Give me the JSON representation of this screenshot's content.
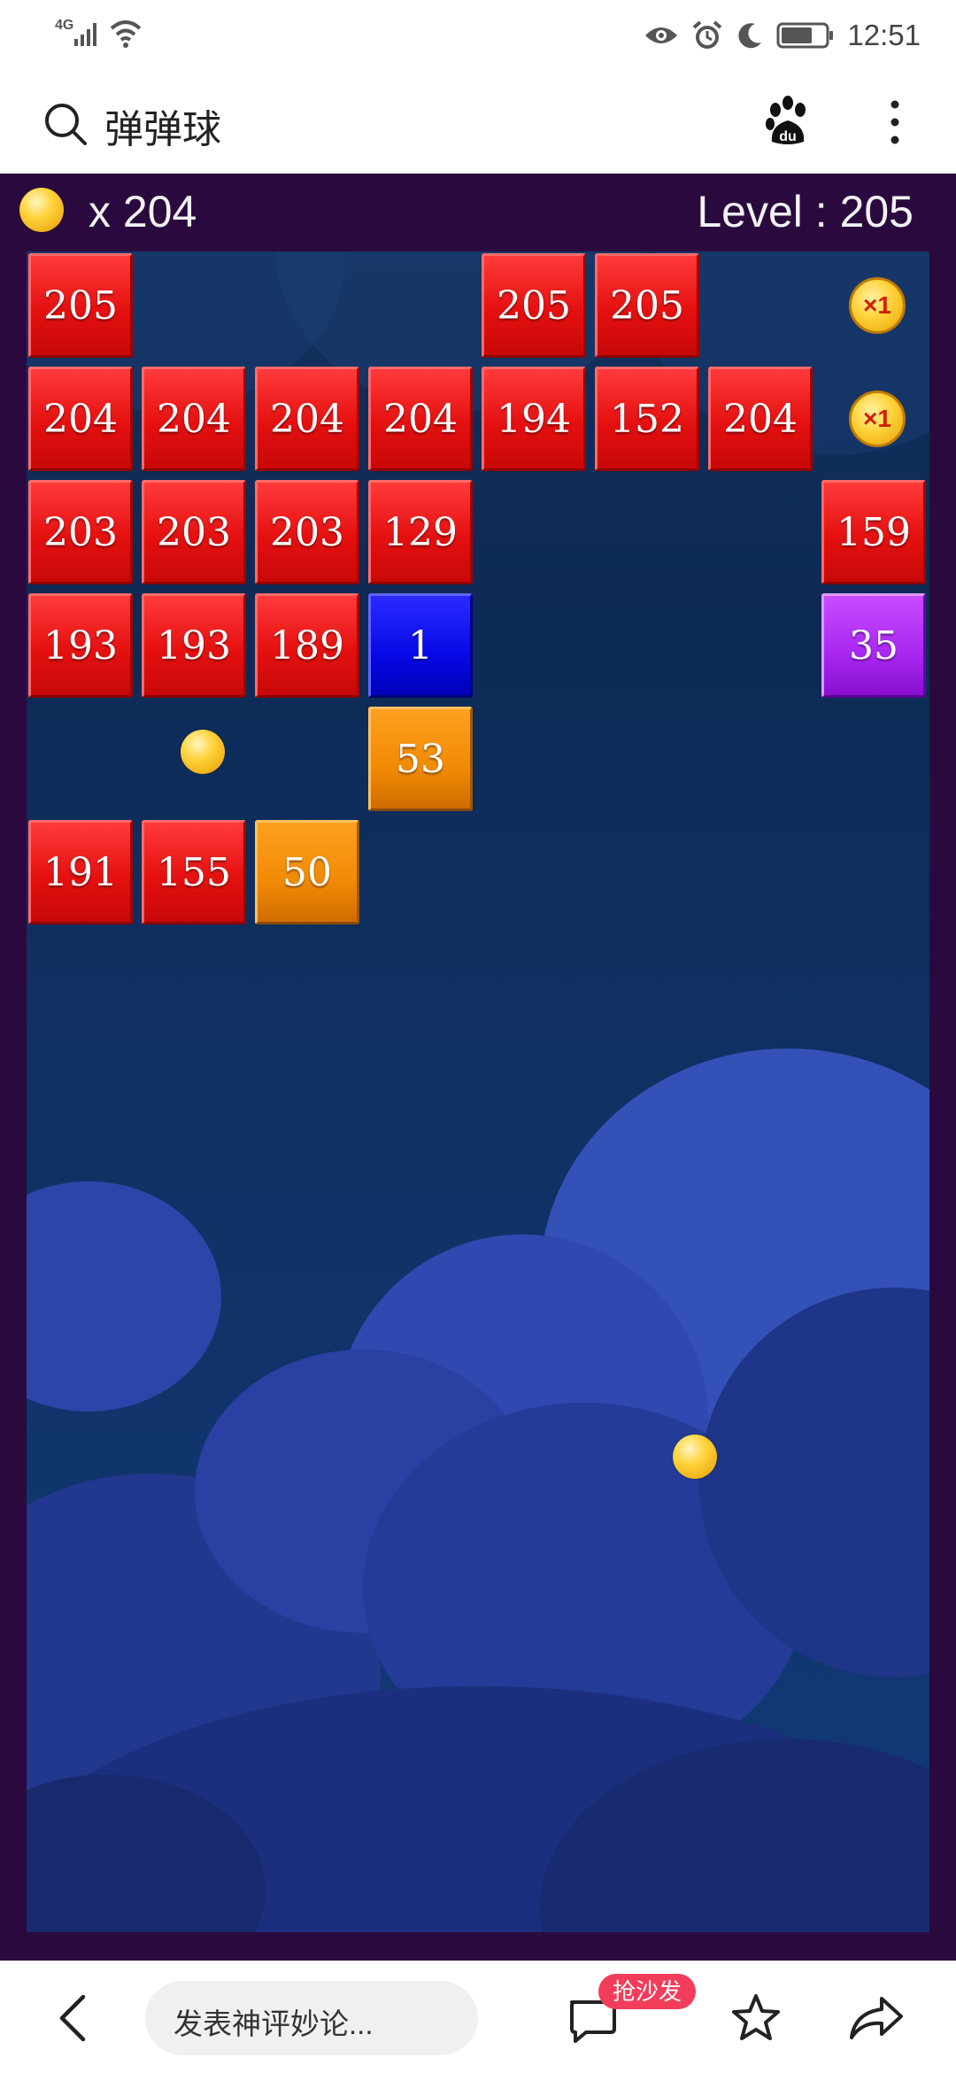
{
  "status_bar": {
    "network": "4G",
    "time": "12:51"
  },
  "search": {
    "query": "弹弹球"
  },
  "game": {
    "coins": "x 204",
    "level": "Level : 205",
    "blocks": [
      {
        "row": 0,
        "col": 0,
        "value": "205",
        "color": "red"
      },
      {
        "row": 0,
        "col": 4,
        "value": "205",
        "color": "red"
      },
      {
        "row": 0,
        "col": 5,
        "value": "205",
        "color": "red"
      },
      {
        "row": 1,
        "col": 0,
        "value": "204",
        "color": "red"
      },
      {
        "row": 1,
        "col": 1,
        "value": "204",
        "color": "red"
      },
      {
        "row": 1,
        "col": 2,
        "value": "204",
        "color": "red"
      },
      {
        "row": 1,
        "col": 3,
        "value": "204",
        "color": "red"
      },
      {
        "row": 1,
        "col": 4,
        "value": "194",
        "color": "red"
      },
      {
        "row": 1,
        "col": 5,
        "value": "152",
        "color": "red"
      },
      {
        "row": 1,
        "col": 6,
        "value": "204",
        "color": "red"
      },
      {
        "row": 2,
        "col": 0,
        "value": "203",
        "color": "red"
      },
      {
        "row": 2,
        "col": 1,
        "value": "203",
        "color": "red"
      },
      {
        "row": 2,
        "col": 2,
        "value": "203",
        "color": "red"
      },
      {
        "row": 2,
        "col": 3,
        "value": "129",
        "color": "red"
      },
      {
        "row": 2,
        "col": 7,
        "value": "159",
        "color": "red"
      },
      {
        "row": 3,
        "col": 0,
        "value": "193",
        "color": "red"
      },
      {
        "row": 3,
        "col": 1,
        "value": "193",
        "color": "red"
      },
      {
        "row": 3,
        "col": 2,
        "value": "189",
        "color": "red"
      },
      {
        "row": 3,
        "col": 3,
        "value": "1",
        "color": "blue"
      },
      {
        "row": 3,
        "col": 7,
        "value": "35",
        "color": "purple"
      },
      {
        "row": 4,
        "col": 3,
        "value": "53",
        "color": "orange"
      },
      {
        "row": 5,
        "col": 0,
        "value": "191",
        "color": "red"
      },
      {
        "row": 5,
        "col": 1,
        "value": "155",
        "color": "red"
      },
      {
        "row": 5,
        "col": 2,
        "value": "50",
        "color": "orange"
      }
    ],
    "powerups": [
      {
        "row": 0,
        "col": 7,
        "label": "×1"
      },
      {
        "row": 1,
        "col": 7,
        "label": "×1"
      }
    ],
    "coin_pickups": [
      {
        "row": 4,
        "col": 1
      }
    ]
  },
  "bottom_bar": {
    "comment_placeholder": "发表神评妙论...",
    "badge": "抢沙发"
  },
  "colors": {
    "red": "#e51010",
    "blue": "#0808e6",
    "orange": "#f08a05",
    "purple": "#a826f0",
    "frame": "#2a0a3e",
    "badge": "#f23d5a"
  }
}
